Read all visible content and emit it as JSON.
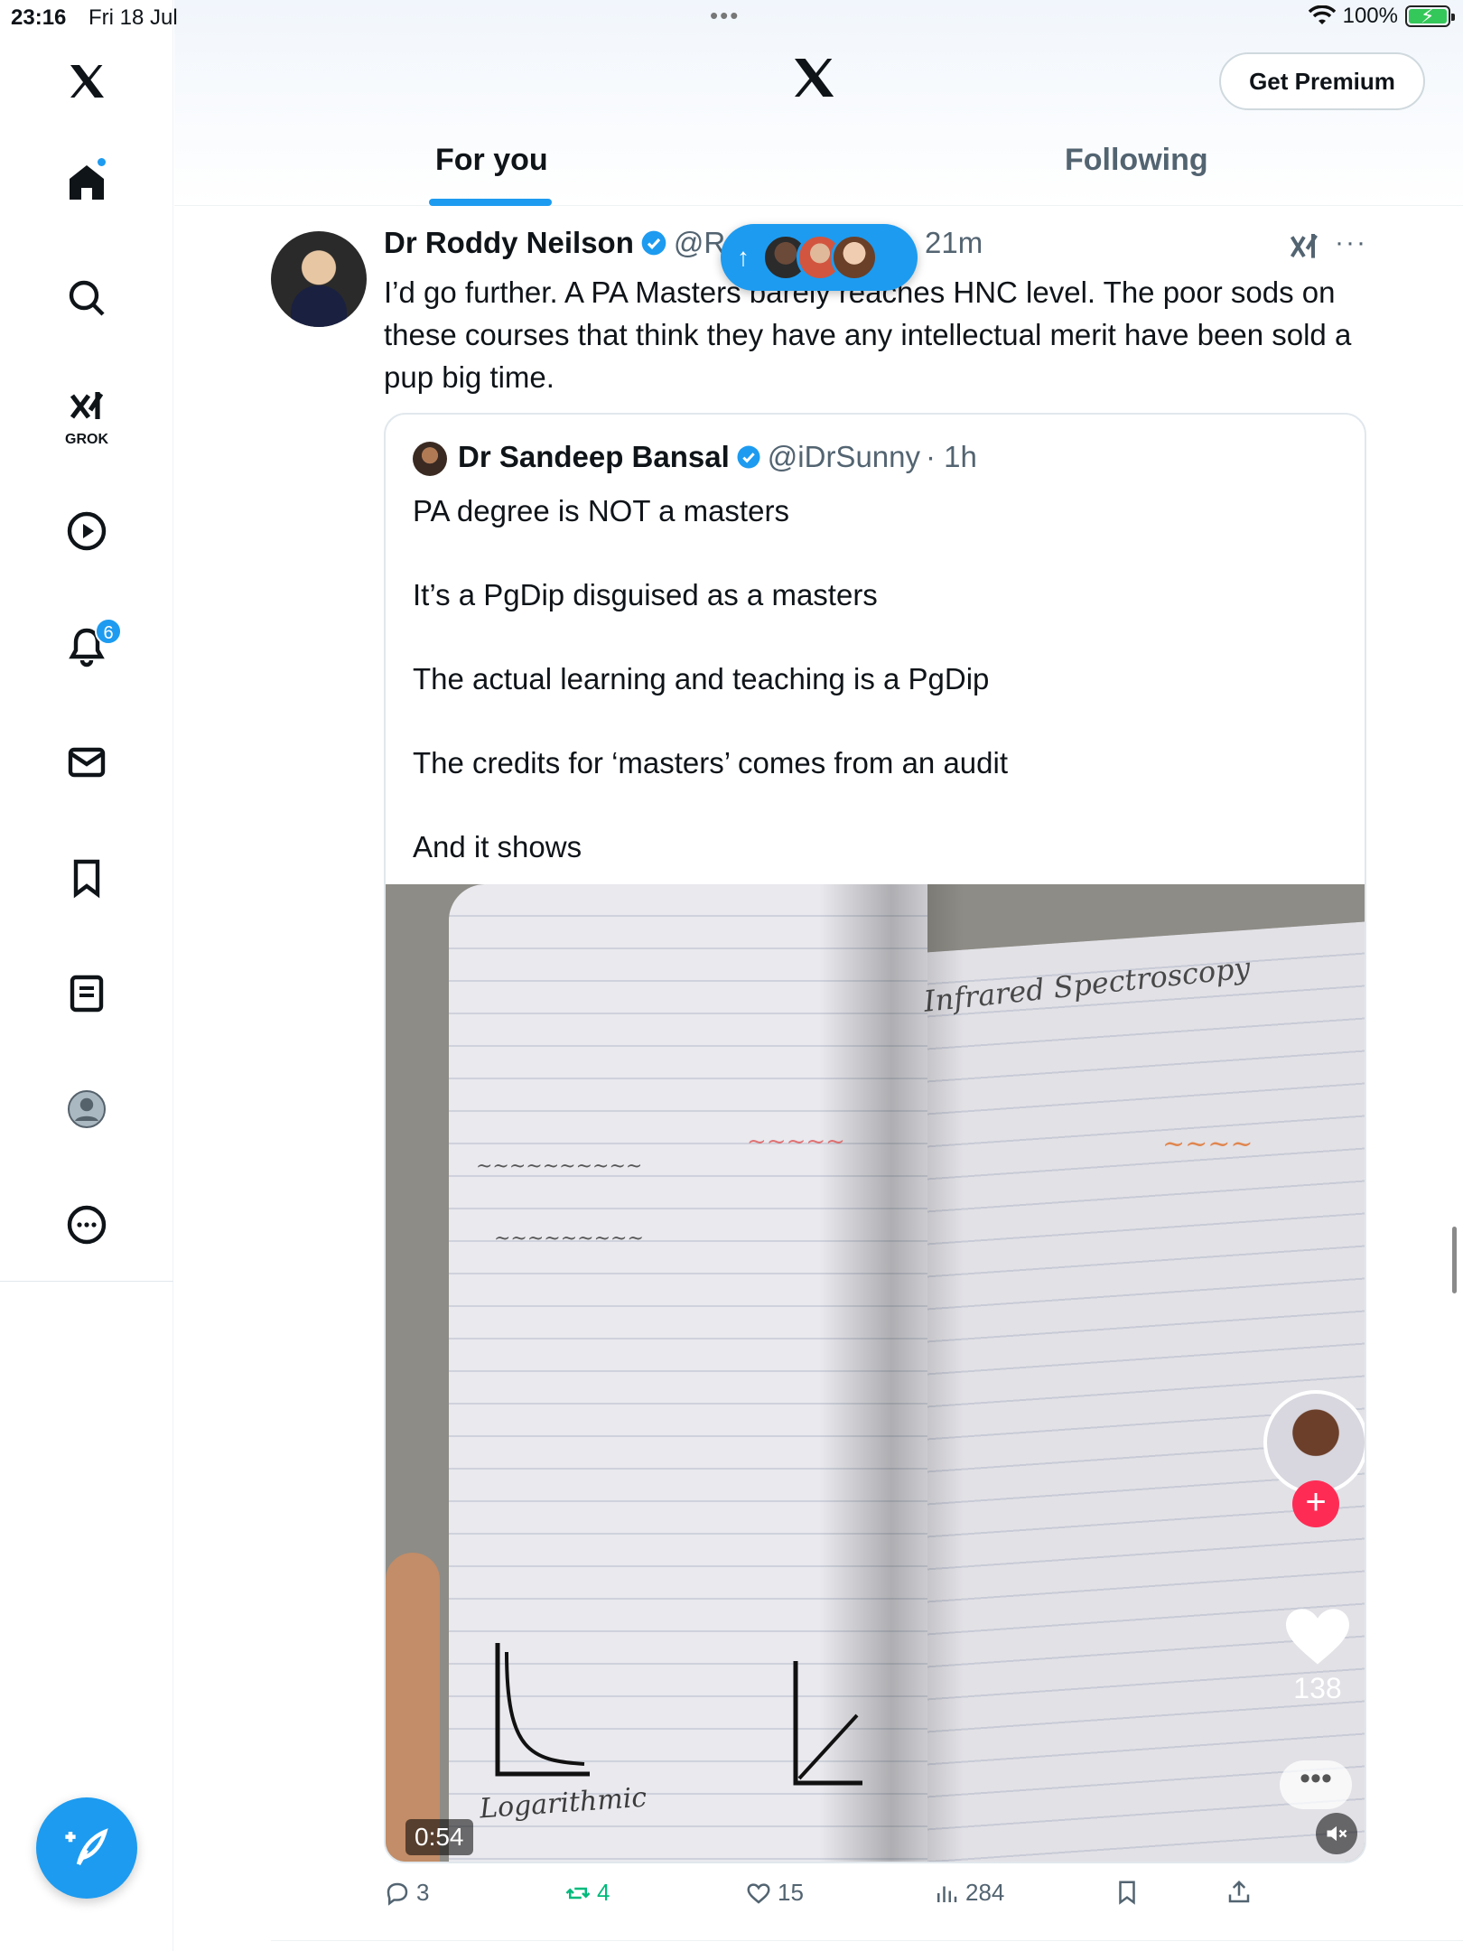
{
  "status_bar": {
    "time": "23:16",
    "date": "Fri 18 Jul",
    "battery_percent": "100%"
  },
  "sidebar": {
    "logo_icon": "x-logo-icon",
    "items": [
      {
        "icon": "home-icon",
        "label": "Home"
      },
      {
        "icon": "search-icon",
        "label": "Explore"
      },
      {
        "icon": "grok-icon",
        "label": "GROK"
      },
      {
        "icon": "play-icon",
        "label": "Videos"
      },
      {
        "icon": "bell-icon",
        "label": "Notifications",
        "badge": "6"
      },
      {
        "icon": "mail-icon",
        "label": "Messages"
      },
      {
        "icon": "bookmark-icon",
        "label": "Bookmarks"
      },
      {
        "icon": "list-icon",
        "label": "Lists"
      },
      {
        "icon": "profile-icon",
        "label": "Profile"
      },
      {
        "icon": "more-icon",
        "label": "More"
      }
    ],
    "compose_icon": "compose-icon"
  },
  "header": {
    "premium_label": "Get Premium",
    "tabs": [
      {
        "label": "For you",
        "active": true
      },
      {
        "label": "Following",
        "active": false
      }
    ]
  },
  "tweet": {
    "author_name": "Dr Roddy Neilson",
    "handle": "@R",
    "time": "21m",
    "text": "I’d go further. A PA Masters barely reaches HNC level. The poor sods on these courses that think they have any intellectual merit have been sold a pup big time.",
    "quote": {
      "author_name": "Dr Sandeep Bansal",
      "handle": "@iDrSunny",
      "time": "· 1h",
      "lines": [
        "PA degree is NOT a masters",
        "It’s a PgDip disguised as a masters",
        "The actual learning and teaching is a PgDip",
        "The credits for ‘masters’ comes from an audit",
        "And it shows"
      ],
      "video": {
        "duration": "0:54",
        "like_count": "138",
        "notebook_heading": "Infrared Spectroscopy",
        "graph_label": "Logarithmic"
      }
    },
    "actions": {
      "replies": "3",
      "reposts": "4",
      "likes": "15",
      "views": "284"
    }
  },
  "colors": {
    "accent": "#1d9bf0",
    "retweet": "#00ba7c",
    "text_secondary": "#536471"
  }
}
